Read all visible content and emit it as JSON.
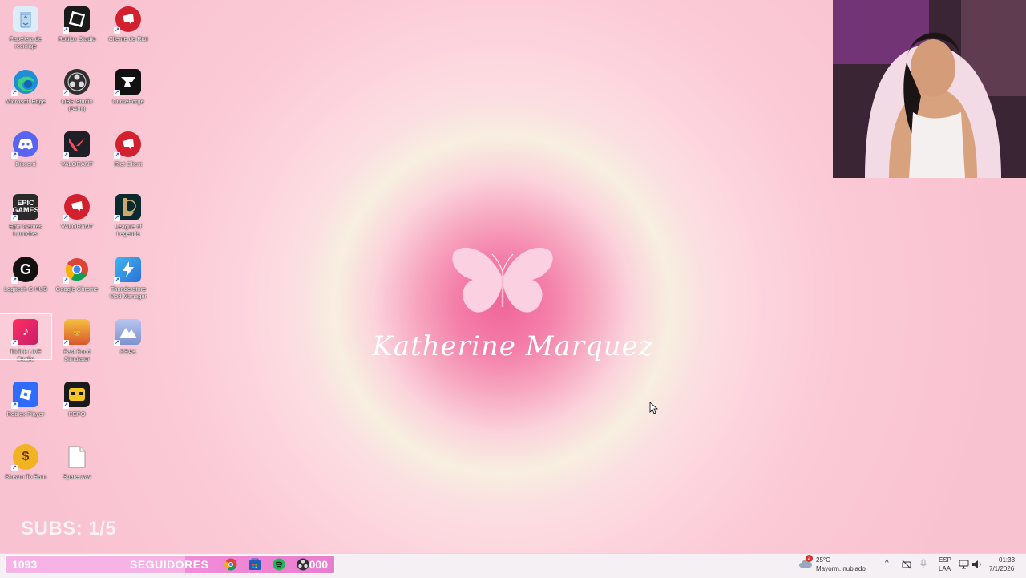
{
  "desktop_icons": [
    {
      "label": "Papelera de reciclaje",
      "icon": "recycle-bin-icon",
      "color": "#e8f2fb"
    },
    {
      "label": "Roblox Studio",
      "icon": "roblox-studio-icon",
      "color": "#1a1a1a"
    },
    {
      "label": "Cliente de Riot",
      "icon": "riot-client-icon",
      "color": "#d3202e"
    },
    {
      "label": "Microsoft Edge",
      "icon": "edge-icon",
      "color": "#1fa3d9"
    },
    {
      "label": "OBS Studio (64bit)",
      "icon": "obs-icon",
      "color": "#302e31"
    },
    {
      "label": "CurseForge",
      "icon": "curseforge-icon",
      "color": "#111111"
    },
    {
      "label": "Discord",
      "icon": "discord-icon",
      "color": "#5865f2"
    },
    {
      "label": "VALORANT",
      "icon": "valorant-icon",
      "color": "#1f1f2a"
    },
    {
      "label": "Riot Client",
      "icon": "riot-client-icon",
      "color": "#d3202e"
    },
    {
      "label": "Epic Games Launcher",
      "icon": "epic-games-icon",
      "color": "#2a2a2a"
    },
    {
      "label": "VALORANT",
      "icon": "riot-client-icon",
      "color": "#d3202e"
    },
    {
      "label": "League of Legends",
      "icon": "league-of-legends-icon",
      "color": "#0b2a2e"
    },
    {
      "label": "Logitech G HUB",
      "icon": "logitech-g-icon",
      "color": "#111111"
    },
    {
      "label": "Google Chrome",
      "icon": "chrome-icon",
      "color": "#ffffff"
    },
    {
      "label": "Thunderstore Mod Manager",
      "icon": "thunderstore-icon",
      "color": "#2b8fd6"
    },
    {
      "label": "TikTok LIVE Studio",
      "icon": "tiktok-live-icon",
      "color": "#e8345a"
    },
    {
      "label": "Fast Food Simulator",
      "icon": "fast-food-simulator-icon",
      "color": "#d9562c"
    },
    {
      "label": "PEAK",
      "icon": "peak-icon",
      "color": "#8ea3d8"
    },
    {
      "label": "Roblox Player",
      "icon": "roblox-player-icon",
      "color": "#2f6bff"
    },
    {
      "label": "REPO",
      "icon": "repo-icon",
      "color": "#1a1a1a"
    },
    {
      "label": "Stream To Earn",
      "icon": "stream-to-earn-icon",
      "color": "#f2b320"
    },
    {
      "label": "Spare.wav",
      "icon": "document-icon",
      "color": "#ffffff"
    }
  ],
  "brand": {
    "name": "Katherine Marquez"
  },
  "overlay": {
    "subs": "SUBS: 1/5",
    "followers_count": "1093",
    "followers_label": "SEGUIDORES",
    "followers_goal": "2000",
    "followers_progress": 0.5465
  },
  "taskbar": {
    "weather_badge": "2",
    "weather_temp": "25°C",
    "weather_desc": "Mayorm. nublado",
    "lang_top": "ESP",
    "lang_bottom": "LAA",
    "time": "01:33",
    "date": "7/1/2026"
  },
  "colors": {
    "accent_pink": "#f0669a",
    "follower_bar": "#f08bd8"
  }
}
